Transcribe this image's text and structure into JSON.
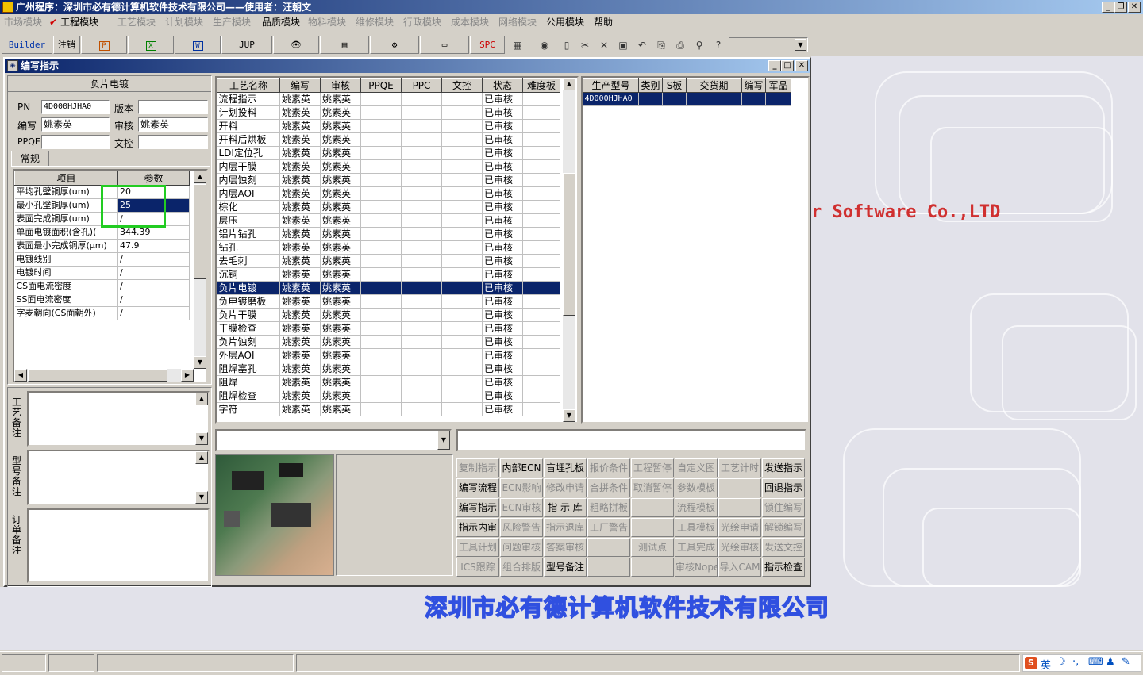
{
  "app": {
    "title": "广州程序：深圳市必有德计算机软件技术有限公司——使用者：汪朝文"
  },
  "menu": {
    "items": [
      {
        "label": "市场模块",
        "enabled": false
      },
      {
        "label": "工程模块",
        "enabled": true,
        "checked": true
      },
      {
        "label": "工艺模块",
        "enabled": false
      },
      {
        "label": "计划模块",
        "enabled": false
      },
      {
        "label": "生产模块",
        "enabled": false
      },
      {
        "label": "品质模块",
        "enabled": true
      },
      {
        "label": "物料模块",
        "enabled": false
      },
      {
        "label": "维修模块",
        "enabled": false
      },
      {
        "label": "行政模块",
        "enabled": false
      },
      {
        "label": "成本模块",
        "enabled": false
      },
      {
        "label": "网络模块",
        "enabled": false
      },
      {
        "label": "公用模块",
        "enabled": true
      },
      {
        "label": "帮助",
        "enabled": true
      }
    ]
  },
  "toolbar": {
    "builder": "Builder",
    "logout": "注销",
    "jup": "JUP",
    "spc": "SPC"
  },
  "background": {
    "english": "r Software Co.,LTD",
    "company": "深圳市必有德计算机软件技术有限公司"
  },
  "window": {
    "title": "编写指示"
  },
  "left": {
    "header": "负片电镀",
    "pn_label": "PN",
    "pn": "4D000HJHA0",
    "version_label": "版本",
    "version": "",
    "writer_label": "编写",
    "writer": "姚素英",
    "review_label": "审核",
    "reviewer": "姚素英",
    "ppqe_label": "PPQE",
    "ppqe": "",
    "doc_label": "文控",
    "doc": "",
    "tab": "常规",
    "param_headers": [
      "项目",
      "参数"
    ],
    "params": [
      {
        "item": "平均孔壁铜厚(um)",
        "value": "20"
      },
      {
        "item": "最小孔壁铜厚(um)",
        "value": "25"
      },
      {
        "item": "表面完成铜厚(um)",
        "value": "/"
      },
      {
        "item": "单面电镀面积(含孔)(",
        "value": "344.39"
      },
      {
        "item": "表面最小完成铜厚(μm)",
        "value": "47.9"
      },
      {
        "item": "电镀线别",
        "value": "/"
      },
      {
        "item": "电镀时间",
        "value": "/"
      },
      {
        "item": "CS面电流密度",
        "value": "/"
      },
      {
        "item": "SS面电流密度",
        "value": "/"
      },
      {
        "item": "字麦朝向(CS面朝外)",
        "value": "/"
      }
    ],
    "remark1": "工艺备注",
    "remark2": "型号备注",
    "remark3": "订单备注"
  },
  "process": {
    "headers": [
      "工艺名称",
      "编写",
      "审核",
      "PPQE",
      "PPC",
      "文控",
      "状态",
      "难度板"
    ],
    "rows": [
      {
        "name": "流程指示",
        "writer": "姚素英",
        "reviewer": "姚素英",
        "status": "已审核"
      },
      {
        "name": "计划投料",
        "writer": "姚素英",
        "reviewer": "姚素英",
        "status": "已审核"
      },
      {
        "name": "开料",
        "writer": "姚素英",
        "reviewer": "姚素英",
        "status": "已审核"
      },
      {
        "name": "开料后烘板",
        "writer": "姚素英",
        "reviewer": "姚素英",
        "status": "已审核"
      },
      {
        "name": "LDI定位孔",
        "writer": "姚素英",
        "reviewer": "姚素英",
        "status": "已审核"
      },
      {
        "name": "内层干膜",
        "writer": "姚素英",
        "reviewer": "姚素英",
        "status": "已审核"
      },
      {
        "name": "内层蚀刻",
        "writer": "姚素英",
        "reviewer": "姚素英",
        "status": "已审核"
      },
      {
        "name": "内层AOI",
        "writer": "姚素英",
        "reviewer": "姚素英",
        "status": "已审核"
      },
      {
        "name": "棕化",
        "writer": "姚素英",
        "reviewer": "姚素英",
        "status": "已审核"
      },
      {
        "name": "层压",
        "writer": "姚素英",
        "reviewer": "姚素英",
        "status": "已审核"
      },
      {
        "name": "铝片钻孔",
        "writer": "姚素英",
        "reviewer": "姚素英",
        "status": "已审核"
      },
      {
        "name": "钻孔",
        "writer": "姚素英",
        "reviewer": "姚素英",
        "status": "已审核"
      },
      {
        "name": "去毛刺",
        "writer": "姚素英",
        "reviewer": "姚素英",
        "status": "已审核"
      },
      {
        "name": "沉铜",
        "writer": "姚素英",
        "reviewer": "姚素英",
        "status": "已审核"
      },
      {
        "name": "负片电镀",
        "writer": "姚素英",
        "reviewer": "姚素英",
        "status": "已审核"
      },
      {
        "name": "负电镀磨板",
        "writer": "姚素英",
        "reviewer": "姚素英",
        "status": "已审核"
      },
      {
        "name": "负片干膜",
        "writer": "姚素英",
        "reviewer": "姚素英",
        "status": "已审核"
      },
      {
        "name": "干膜检查",
        "writer": "姚素英",
        "reviewer": "姚素英",
        "status": "已审核"
      },
      {
        "name": "负片蚀刻",
        "writer": "姚素英",
        "reviewer": "姚素英",
        "status": "已审核"
      },
      {
        "name": "外层AOI",
        "writer": "姚素英",
        "reviewer": "姚素英",
        "status": "已审核"
      },
      {
        "name": "阻焊塞孔",
        "writer": "姚素英",
        "reviewer": "姚素英",
        "status": "已审核"
      },
      {
        "name": "阻焊",
        "writer": "姚素英",
        "reviewer": "姚素英",
        "status": "已审核"
      },
      {
        "name": "阻焊检查",
        "writer": "姚素英",
        "reviewer": "姚素英",
        "status": "已审核"
      },
      {
        "name": "字符",
        "writer": "姚素英",
        "reviewer": "姚素英",
        "status": "已审核"
      }
    ]
  },
  "models": {
    "headers": [
      "生产型号",
      "类别",
      "S板",
      "交货期",
      "编写",
      "军品"
    ],
    "rows": [
      {
        "model": "4D000HJHA0"
      }
    ]
  },
  "actions": [
    [
      "复制指示",
      "内部ECN",
      "盲埋孔板",
      "报价条件",
      "工程暂停",
      "自定义图",
      "工艺计时",
      "发送指示"
    ],
    [
      "编写流程",
      "ECN影响",
      "修改申请",
      "合拼条件",
      "取消暂停",
      "参数模板",
      "",
      "回退指示"
    ],
    [
      "编写指示",
      "ECN审核",
      "指 示 库",
      "粗略拼板",
      "",
      "流程模板",
      "",
      "锁住编写"
    ],
    [
      "指示内审",
      "风险警告",
      "指示退库",
      "工厂警告",
      "",
      "工具模板",
      "光绘申请",
      "解锁编写"
    ],
    [
      "工具计划",
      "问题审核",
      "答案审核",
      "",
      "测试点",
      "工具完成",
      "光绘审核",
      "发送文控"
    ],
    [
      "ICS跟踪",
      "组合排版",
      "型号备注",
      "",
      "",
      "审核Nope",
      "导入CAM",
      "指示检查"
    ]
  ],
  "actions_enabled": [
    [
      false,
      true,
      true,
      false,
      false,
      false,
      false,
      true
    ],
    [
      true,
      false,
      false,
      false,
      false,
      false,
      false,
      true
    ],
    [
      true,
      false,
      true,
      false,
      false,
      false,
      false,
      false
    ],
    [
      true,
      false,
      false,
      false,
      false,
      false,
      false,
      false
    ],
    [
      false,
      false,
      false,
      false,
      false,
      false,
      false,
      false
    ],
    [
      false,
      false,
      true,
      false,
      false,
      false,
      false,
      true
    ]
  ],
  "tray": {
    "ime": "英"
  },
  "colors": {
    "titlebar": "#0a246a",
    "selection": "#0a246a",
    "highlight_box": "#22cc22",
    "brand_red": "#d03030",
    "brand_blue": "#3050e0"
  }
}
